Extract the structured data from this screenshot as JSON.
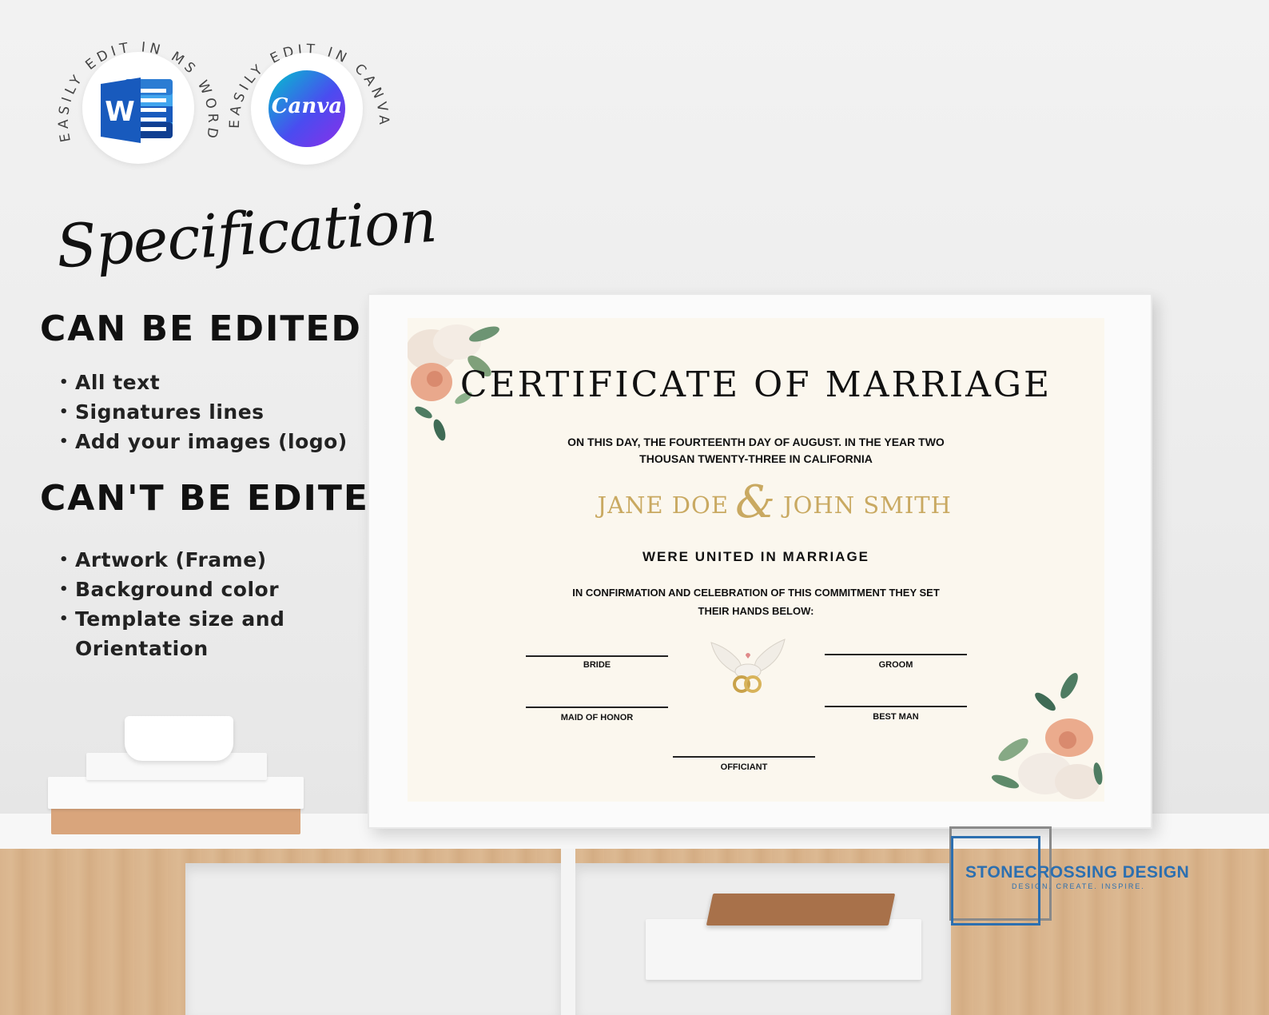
{
  "badges": {
    "word": {
      "arc_text": "EASILY EDIT IN MS WORD",
      "icon": "ms-word-icon",
      "icon_color": "#185abd"
    },
    "canva": {
      "arc_text": "EASILY EDIT IN CANVA",
      "logo_text": "Canva",
      "icon_color": "#7d2ae8"
    }
  },
  "spec": {
    "script_title": "Specification",
    "can_heading": "CAN BE EDITED",
    "can_items": [
      "All text",
      "Signatures lines",
      "Add your images (logo)"
    ],
    "cant_heading": "CAN'T BE EDITED",
    "cant_items": [
      "Artwork (Frame)",
      "Background color",
      "Template size and",
      "Orientation"
    ]
  },
  "certificate": {
    "title": "CERTIFICATE OF MARRIAGE",
    "intro_line1": "ON THIS DAY, THE FOURTEENTH DAY OF AUGUST. IN THE YEAR TWO",
    "intro_line2": "THOUSAN TWENTY-THREE IN CALIFORNIA",
    "name_left": "JANE DOE",
    "ampersand": "&",
    "name_right": "JOHN SMITH",
    "united": "WERE UNITED IN MARRIAGE",
    "confirm_line1": "IN CONFIRMATION AND CELEBRATION OF THIS COMMITMENT THEY SET",
    "confirm_line2": "THEIR HANDS BELOW:",
    "signatures": {
      "bride": "BRIDE",
      "groom": "GROOM",
      "maid_of_honor": "MAID OF HONOR",
      "best_man": "BEST MAN",
      "officiant": "OFFICIANT"
    },
    "accent_color": "#c9a961"
  },
  "brand": {
    "name": "STONECROSSING DESIGN",
    "tagline": "DESIGN. CREATE. INSPIRE.",
    "color": "#2c6fb0"
  }
}
